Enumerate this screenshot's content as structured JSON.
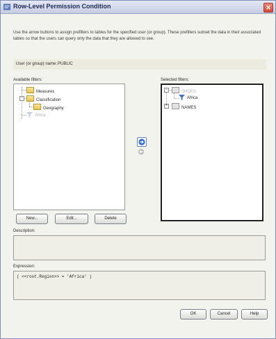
{
  "window": {
    "title": "Row-Level Permission Condition",
    "close_glyph": "✕"
  },
  "intro_text": "Use the arrow buttons to assign prefilters to tables for the specified user (or group). These prefilters subset the data in their associated tables so that the users can query only the data that they are allowed to see.",
  "user": {
    "label": "User (or group) name:",
    "value": "PUBLIC"
  },
  "available": {
    "label": "Available filters:",
    "items": [
      {
        "label": "Measures",
        "icon": "folder-icon"
      },
      {
        "label": "Classification",
        "icon": "folder-icon"
      },
      {
        "label": "Geography",
        "icon": "folder-icon"
      },
      {
        "label": "Africa",
        "icon": "filter-icon"
      }
    ]
  },
  "selected": {
    "label": "Selected filters:",
    "items": [
      {
        "label": "SHOES",
        "icon": "table-icon"
      },
      {
        "label": "Africa",
        "icon": "filter-icon"
      },
      {
        "label": "NAMES",
        "icon": "table-icon"
      }
    ]
  },
  "buttons": {
    "new": "New...",
    "edit": "Edit...",
    "delete": "Delete",
    "ok": "OK",
    "cancel": "Cancel",
    "help": "Help"
  },
  "description": {
    "label": "Description:",
    "value": ""
  },
  "expression": {
    "label": "Expression:",
    "value": "( <<root.Region>> = 'Africa' )"
  },
  "colors": {
    "accent": "#2f6fd6",
    "title_text": "#1f2a52"
  }
}
